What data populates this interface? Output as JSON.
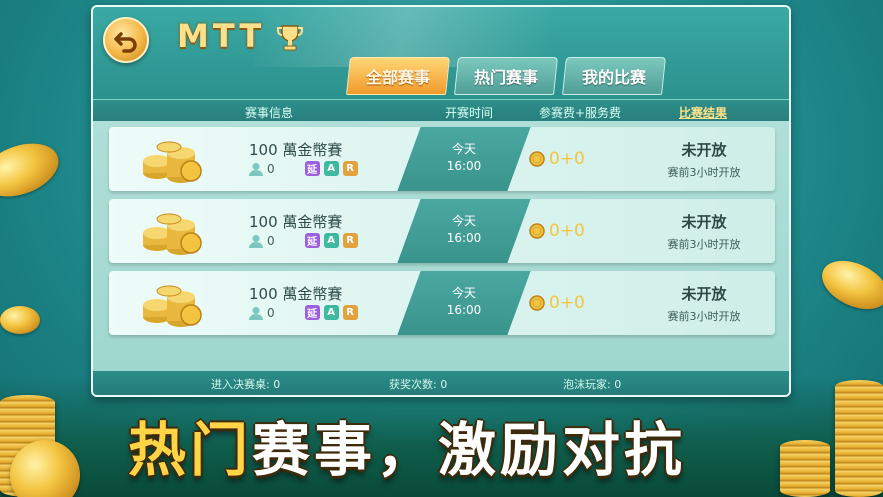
{
  "header": {
    "title": "MTT"
  },
  "tabs": [
    {
      "label": "全部赛事",
      "active": true
    },
    {
      "label": "热门赛事",
      "active": false
    },
    {
      "label": "我的比赛",
      "active": false
    }
  ],
  "columns": {
    "info": "赛事信息",
    "time": "开赛时间",
    "fee": "参赛费+服务费",
    "result": "比赛结果"
  },
  "tournaments": [
    {
      "name": "100 萬金幣賽",
      "players": "0",
      "badges": [
        "延",
        "A",
        "R"
      ],
      "day": "今天",
      "time": "16:00",
      "fee": "0+0",
      "status": "未开放",
      "note": "赛前3小时开放"
    },
    {
      "name": "100 萬金幣賽",
      "players": "0",
      "badges": [
        "延",
        "A",
        "R"
      ],
      "day": "今天",
      "time": "16:00",
      "fee": "0+0",
      "status": "未开放",
      "note": "赛前3小时开放"
    },
    {
      "name": "100 萬金幣賽",
      "players": "0",
      "badges": [
        "延",
        "A",
        "R"
      ],
      "day": "今天",
      "time": "16:00",
      "fee": "0+0",
      "status": "未开放",
      "note": "赛前3小时开放"
    }
  ],
  "footer": {
    "final_table": "进入决赛桌: 0",
    "awards": "获奖次数: 0",
    "bubble": "泡沫玩家: 0"
  },
  "banner": {
    "part1": "热门",
    "part2": "赛事，",
    "part3": "激励对抗"
  },
  "icons": {
    "back": "back-arrow-icon",
    "trophy": "trophy-icon",
    "user": "user-icon",
    "coin": "coin-icon"
  },
  "colors": {
    "accent_gold": "#ffd447",
    "tab_active": "#f09a2a",
    "badge_yan": "#9b5fe0",
    "badge_a": "#3fb8a0",
    "badge_r": "#e0a340"
  }
}
